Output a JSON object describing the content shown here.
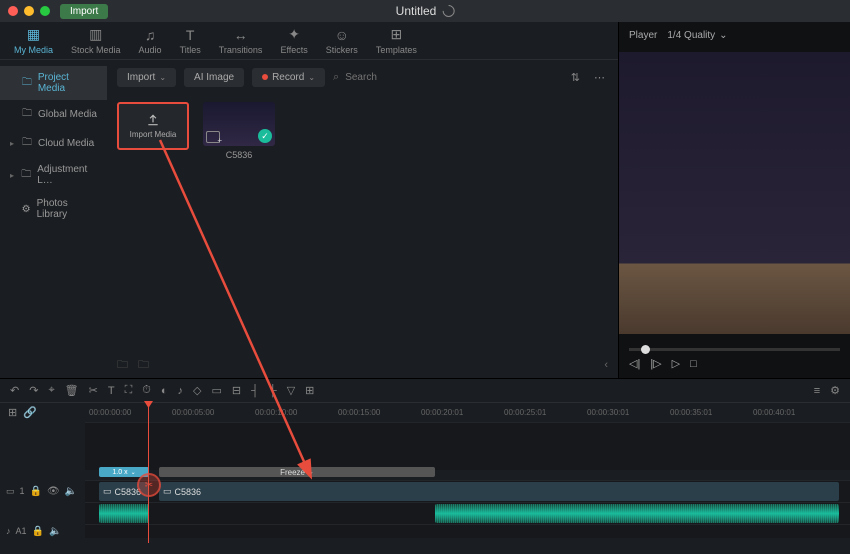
{
  "titlebar": {
    "import": "Import",
    "title": "Untitled"
  },
  "mainTabs": [
    {
      "label": "My Media",
      "glyph": "▦",
      "active": true
    },
    {
      "label": "Stock Media",
      "glyph": "▥"
    },
    {
      "label": "Audio",
      "glyph": "♫"
    },
    {
      "label": "Titles",
      "glyph": "T"
    },
    {
      "label": "Transitions",
      "glyph": "↔"
    },
    {
      "label": "Effects",
      "glyph": "✦"
    },
    {
      "label": "Stickers",
      "glyph": "☺"
    },
    {
      "label": "Templates",
      "glyph": "⊞"
    }
  ],
  "sidebar": {
    "items": [
      {
        "label": "Project Media",
        "active": true,
        "expandable": false
      },
      {
        "label": "Global Media",
        "expandable": false
      },
      {
        "label": "Cloud Media",
        "expandable": true
      },
      {
        "label": "Adjustment L…",
        "expandable": true
      },
      {
        "label": "Photos Library",
        "expandable": false,
        "gear": true
      }
    ]
  },
  "toolbar": {
    "import": "Import",
    "ai_image": "AI Image",
    "record": "Record",
    "search_placeholder": "Search"
  },
  "thumbs": {
    "import_media": "Import Media",
    "clip1": "C5836"
  },
  "preview": {
    "player_label": "Player",
    "quality": "1/4 Quality"
  },
  "ruler": [
    "00:00:00:00",
    "00:00:05:00",
    "00:00:10:00",
    "00:00:15:00",
    "00:00:20:01",
    "00:00:25:01",
    "00:00:30:01",
    "00:00:35:01",
    "00:00:40:01"
  ],
  "timeline": {
    "trans_label": "1.0 x",
    "freeze_label": "Freeze",
    "clip_a": "C5836",
    "clip_b": "C5836",
    "track_video": "1",
    "track_audio": "A1"
  }
}
